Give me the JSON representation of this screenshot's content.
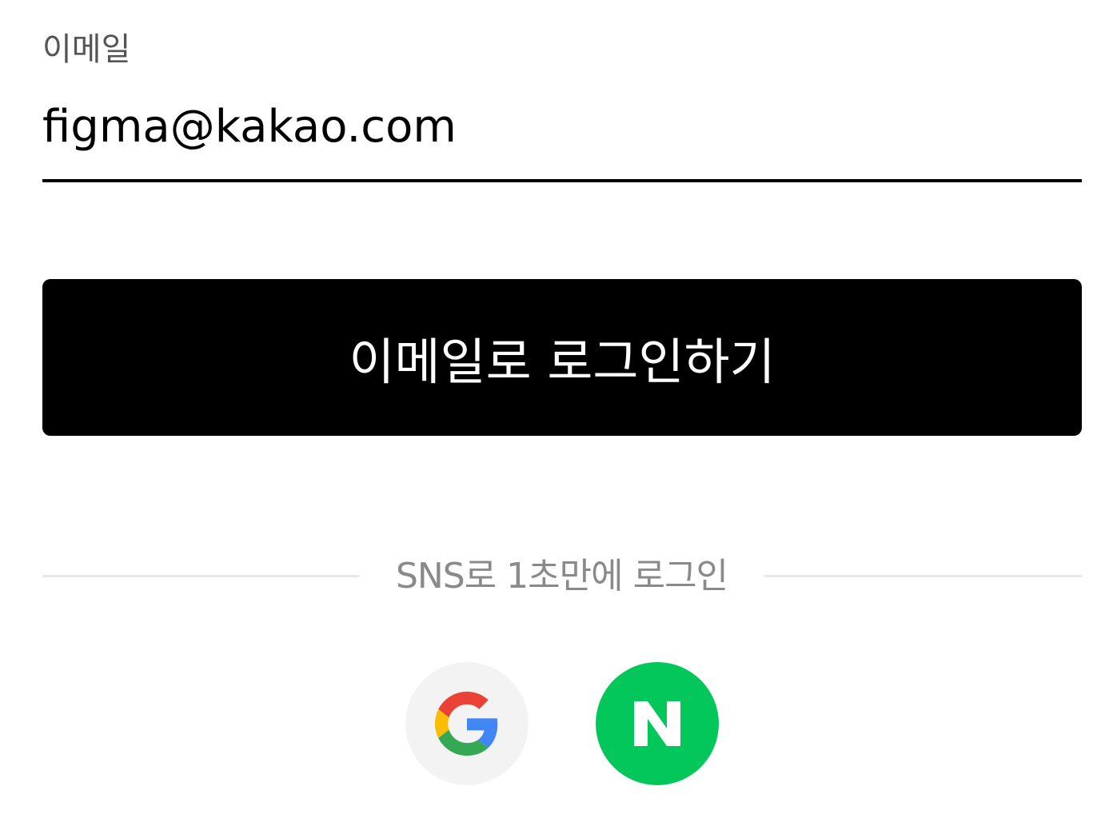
{
  "email_field": {
    "label": "이메일",
    "value": "figma@kakao.com"
  },
  "login_button": {
    "label": "이메일로 로그인하기"
  },
  "sns": {
    "divider_text": "SNS로 1초만에 로그인",
    "providers": [
      {
        "name": "google",
        "icon": "google-g-icon",
        "bg_color": "#f3f3f3"
      },
      {
        "name": "naver",
        "icon": "naver-n-icon",
        "bg_color": "#03c75a"
      }
    ]
  },
  "colors": {
    "primary": "#000000",
    "label_gray": "#555555",
    "divider_text": "#8a8a8a",
    "divider_line": "#e8e8e8",
    "naver_green": "#03c75a",
    "google_blue": "#4285f4",
    "google_red": "#ea4335",
    "google_yellow": "#fbbc05",
    "google_green": "#34a853"
  }
}
